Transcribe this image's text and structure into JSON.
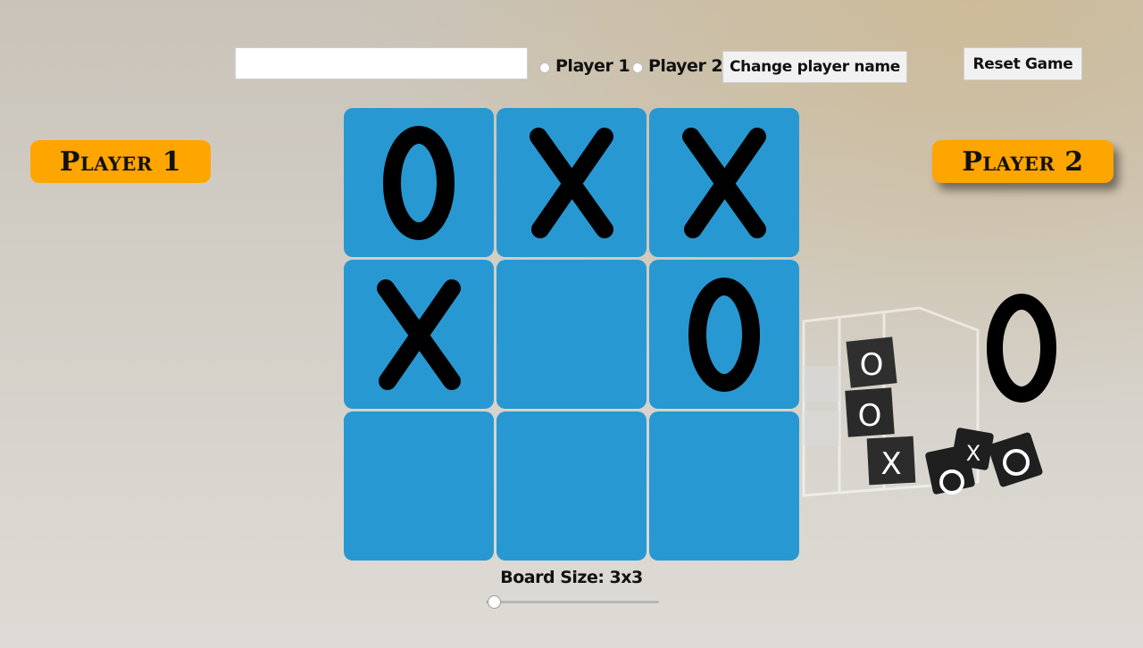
{
  "controls": {
    "name_input_value": "",
    "radio_player1_label": "Player 1",
    "radio_player2_label": "Player 2",
    "change_name_label": "Change player name",
    "reset_label": "Reset Game"
  },
  "players": {
    "player1_label": "Player 1",
    "player2_label": "Player 2",
    "active_player": "Player 2"
  },
  "board": {
    "cells": [
      "O",
      "X",
      "X",
      "X",
      "",
      "O",
      "",
      "",
      ""
    ]
  },
  "turn_indicator": {
    "symbol": "O"
  },
  "board_size": {
    "label": "Board Size: 3x3",
    "value": 3
  },
  "colors": {
    "cell": "#2898d2",
    "badge": "#ffa500"
  }
}
